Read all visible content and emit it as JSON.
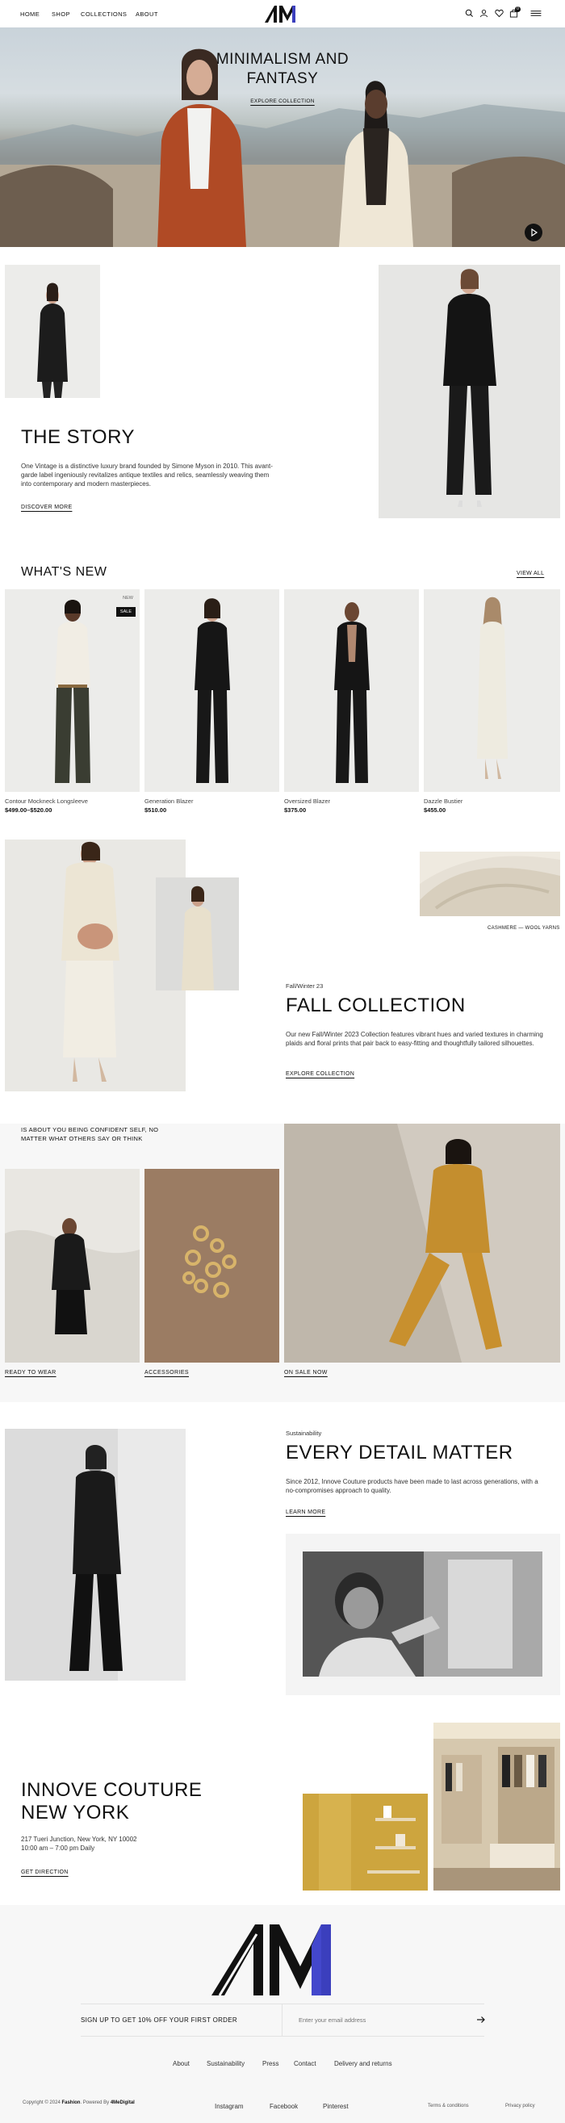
{
  "header": {
    "nav": [
      "HOME",
      "SHOP",
      "COLLECTIONS",
      "ABOUT"
    ],
    "logo": "AMI",
    "icons": [
      "search-icon",
      "user-icon",
      "heart-icon",
      "bag-icon",
      "menu-icon"
    ],
    "cart_count": "0"
  },
  "hero": {
    "title_line1": "MINIMALISM AND",
    "title_line2": "FANTASY",
    "cta": "EXPLORE COLLECTION"
  },
  "story": {
    "title": "THE STORY",
    "text": "One Vintage is a distinctive luxury brand founded by Simone Myson in 2010. This avant-garde label ingeniously revitalizes antique textiles and relics, seamlessly weaving them into contemporary and modern masterpieces.",
    "cta": "DISCOVER MORE"
  },
  "whats_new": {
    "title": "WHAT'S NEW",
    "view_all": "VIEW ALL",
    "badge_new": "NEW",
    "badge_sale": "SALE",
    "products": [
      {
        "name": "Contour Mockneck Longsleeve",
        "price": "$499.00–$520.00"
      },
      {
        "name": "Generation Blazer",
        "price": "$510.00"
      },
      {
        "name": "Oversized Blazer",
        "price": "$375.00"
      },
      {
        "name": "Dazzle Bustier",
        "price": "$455.00"
      }
    ]
  },
  "fall": {
    "caption": "CASHMERE — WOOL YARNS",
    "eyebrow": "Fall/Winter 23",
    "title": "FALL COLLECTION",
    "text": "Our new Fall/Winter 2023 Collection features vibrant hues and varied textures in charming plaids and floral prints that pair back to easy-fitting and thoughtfully tailored silhouettes.",
    "cta": "EXPLORE COLLECTION"
  },
  "confident": {
    "quote": "IS ABOUT YOU BEING CONFIDENT SELF, NO MATTER WHAT OTHERS SAY OR THINK",
    "tiles": [
      "READY TO WEAR",
      "ACCESSORIES",
      "ON SALE NOW"
    ]
  },
  "detail": {
    "eyebrow": "Sustainability",
    "title": "EVERY DETAIL MATTER",
    "text": "Since 2012, Innove Couture products have been made to last across generations, with a no-compromises approach to quality.",
    "cta": "LEARN MORE"
  },
  "store": {
    "title_line1": "INNOVE COUTURE",
    "title_line2": "NEW YORK",
    "address": "217 Tueri Junction, New York, NY 10002",
    "hours": "10:00 am – 7:00 pm Daily",
    "cta": "GET DIRECTION"
  },
  "footer": {
    "newsletter": "SIGN UP TO GET 10% OFF YOUR FIRST ORDER",
    "email_placeholder": "Enter your email address",
    "links": [
      "About",
      "Sustainability",
      "Press",
      "Contact",
      "Delivery and returns"
    ],
    "copyright_prefix": "Copyright © 2024 ",
    "brand": "Fashion",
    "powered_by": ". Powered By ",
    "powered_brand": "4MeDigital",
    "social": [
      "Instagram",
      "Facebook",
      "Pinterest"
    ],
    "legal": [
      "Terms & conditions",
      "Privacy policy"
    ],
    "accent": "#3b3fbd"
  }
}
